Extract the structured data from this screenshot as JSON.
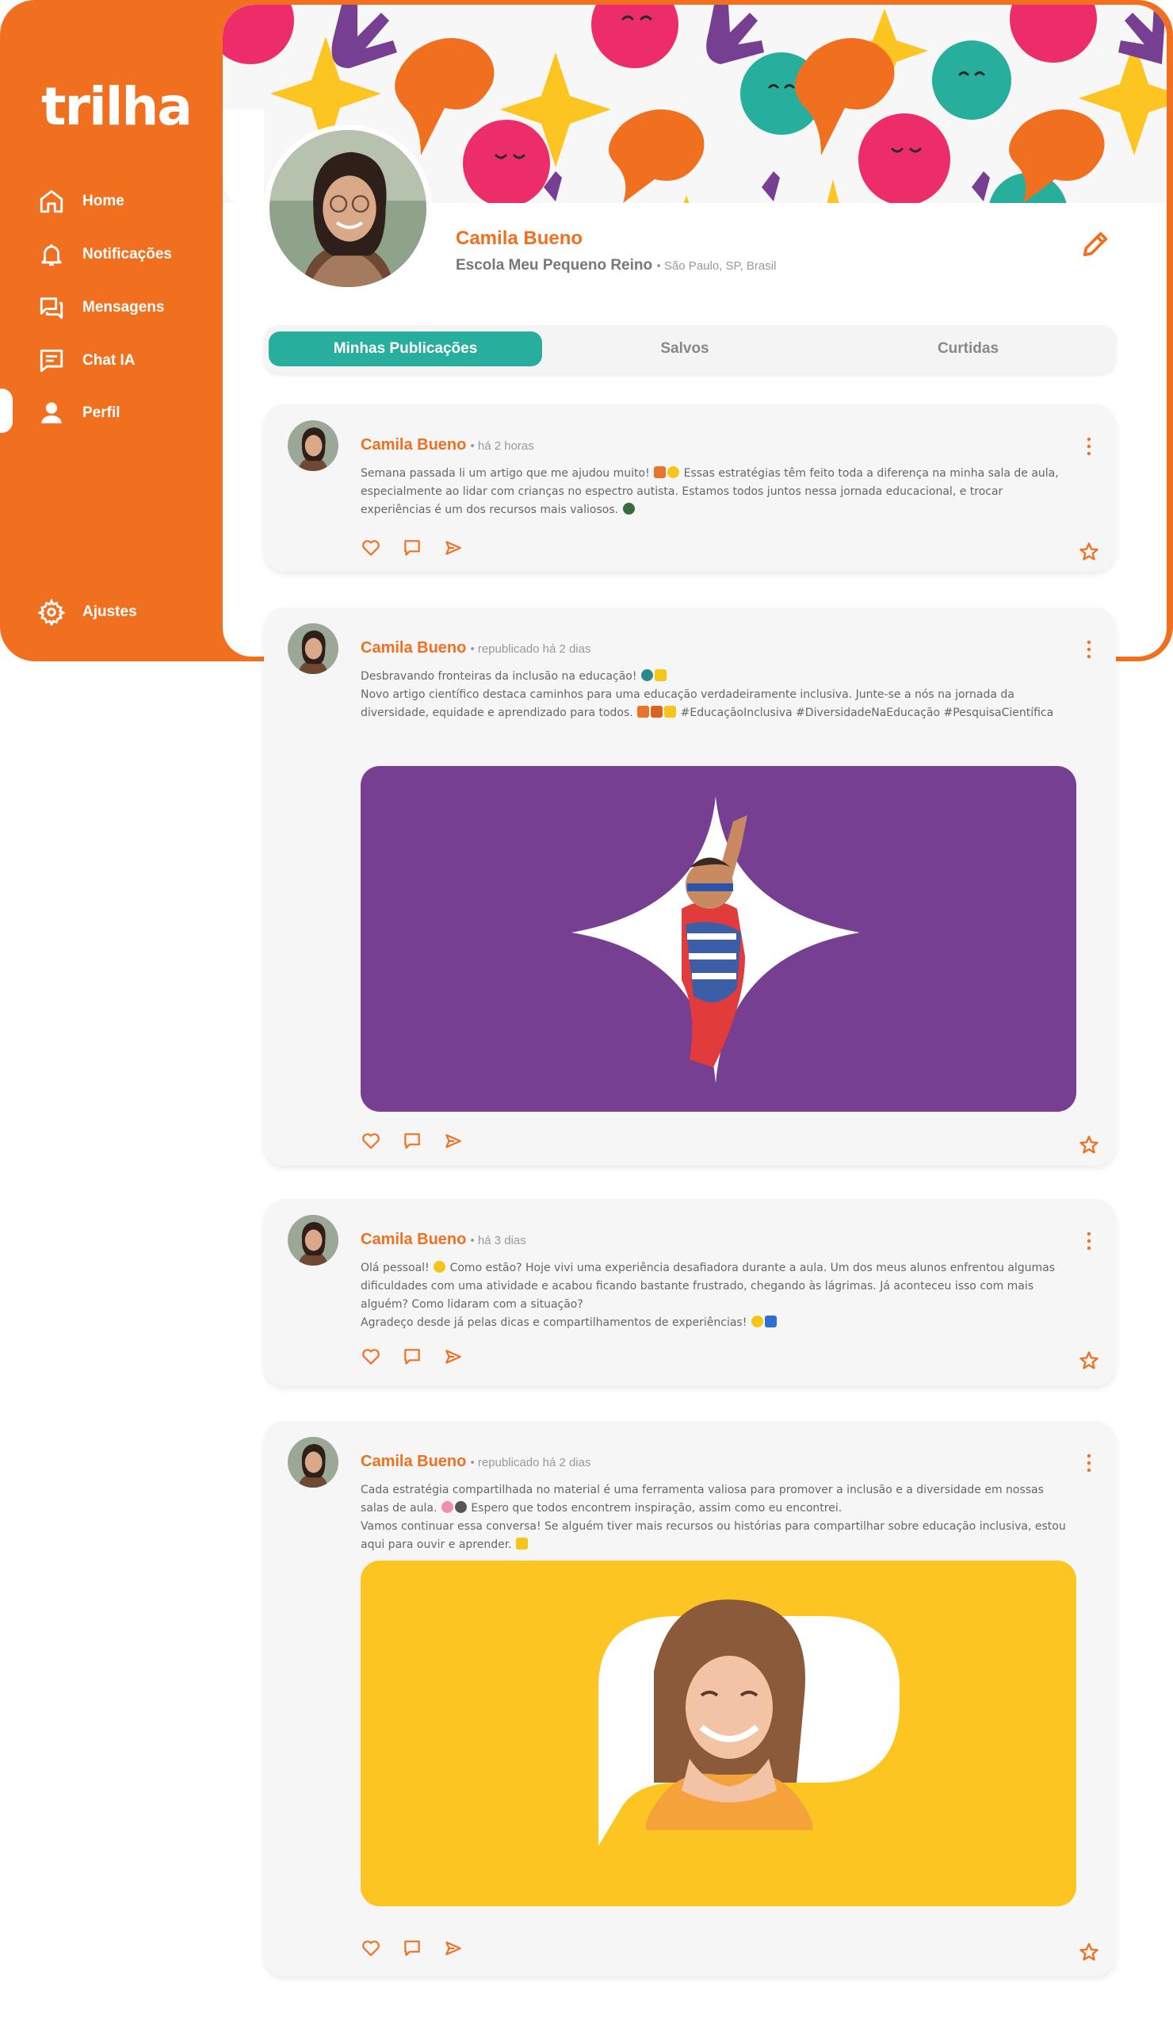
{
  "app": {
    "logo": "trilha"
  },
  "sidebar": {
    "items": [
      {
        "label": "Home",
        "icon": "home-icon"
      },
      {
        "label": "Notificações",
        "icon": "bell-icon"
      },
      {
        "label": "Mensagens",
        "icon": "messages-icon"
      },
      {
        "label": "Chat IA",
        "icon": "chat-ai-icon"
      },
      {
        "label": "Perfil",
        "icon": "user-icon",
        "active": true
      }
    ],
    "settings": {
      "label": "Ajustes",
      "icon": "gear-icon"
    }
  },
  "profile": {
    "name": "Camila Bueno",
    "school": "Escola Meu Pequeno Reino",
    "separator": "•",
    "location": "São Paulo, SP, Brasil"
  },
  "tabs": [
    {
      "label": "Minhas Publicações",
      "active": true
    },
    {
      "label": "Salvos"
    },
    {
      "label": "Curtidas"
    }
  ],
  "posts": [
    {
      "author": "Camila Bueno",
      "meta": "• há 2 horas",
      "lines": [
        "Semana passada li um artigo que me ajudou muito!",
        "Essas estratégias têm feito toda a diferença na minha sala de aula, especialmente ao lidar com crianças no espectro autista.  Estamos todos juntos nessa jornada educacional, e trocar experiências é um dos recursos mais valiosos."
      ]
    },
    {
      "author": "Camila Bueno",
      "meta": "• republicado há 2 dias",
      "lines": [
        "Desbravando fronteiras da inclusão na educação!",
        "Novo artigo científico destaca caminhos para uma educação verdadeiramente inclusiva. Junte-se a nós na jornada da diversidade, equidade e aprendizado para todos.",
        "#EducaçãoInclusiva #DiversidadeNaEducação #PesquisaCientífica"
      ],
      "media": "star-shaped-photo-boy-superhero"
    },
    {
      "author": "Camila Bueno",
      "meta": "• há 3 dias",
      "lines": [
        "Olá pessoal!",
        "Como estão? Hoje vivi uma experiência desafiadora durante a aula. Um dos meus alunos enfrentou algumas dificuldades com uma atividade e acabou ficando bastante frustrado, chegando às lágrimas. Já aconteceu isso com mais alguém? Como lidaram com a situação?",
        "Agradeço desde já pelas dicas e compartilhamentos de experiências!"
      ]
    },
    {
      "author": "Camila Bueno",
      "meta": "• republicado há 2 dias",
      "lines": [
        "Cada estratégia compartilhada no material é uma ferramenta valiosa para promover a inclusão e a diversidade em nossas salas de aula.",
        "Espero que todos encontrem inspiração, assim como eu encontrei.",
        "Vamos continuar essa conversa! Se alguém tiver mais recursos ou histórias para compartilhar sobre educação inclusiva, estou aqui para ouvir e aprender."
      ],
      "media": "speech-bubble-photo-smiling-girl"
    }
  ],
  "colors": {
    "brand_orange": "#F07020",
    "teal": "#27AE9D",
    "purple": "#773F91",
    "yellow": "#FDC521",
    "pink": "#EC2D6A"
  }
}
